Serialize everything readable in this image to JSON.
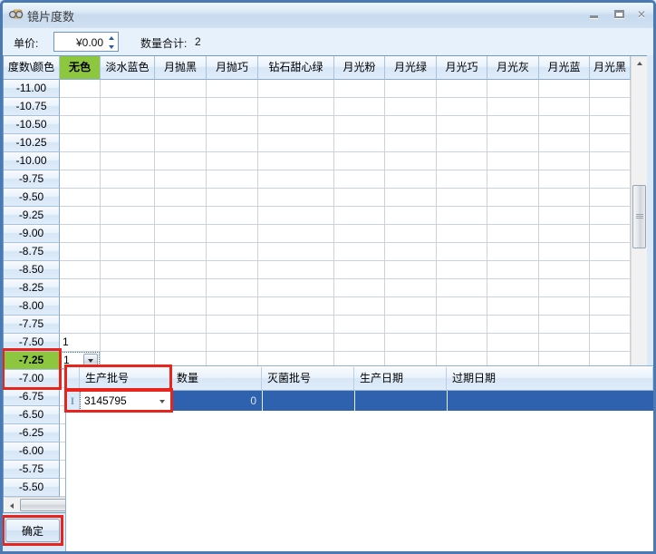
{
  "window": {
    "title": "镜片度数",
    "buttons": {
      "minimize": "minimize",
      "maximize": "maximize",
      "close": "✕"
    }
  },
  "toolbar": {
    "unit_price_label": "单价:",
    "unit_price_value": "¥0.00",
    "quantity_total_label": "数量合计:",
    "quantity_total_value": "2"
  },
  "grid": {
    "corner_header": "度数\\颜色",
    "columns": [
      "无色",
      "淡水蓝色",
      "月抛黑",
      "月抛巧",
      "钻石甜心绿",
      "月光粉",
      "月光绿",
      "月光巧",
      "月光灰",
      "月光蓝",
      "月光黑"
    ],
    "selected_column": "无色",
    "rows": [
      "-11.00",
      "-10.75",
      "-10.50",
      "-10.25",
      "-10.00",
      "-9.75",
      "-9.50",
      "-9.25",
      "-9.00",
      "-8.75",
      "-8.50",
      "-8.25",
      "-8.00",
      "-7.75",
      "-7.50",
      "-7.25",
      "-7.00",
      "-6.75",
      "-6.50",
      "-6.25",
      "-6.00",
      "-5.75",
      "-5.50"
    ],
    "selected_row": "-7.25",
    "cells": [
      {
        "row": "-7.50",
        "column": "无色",
        "value": "1",
        "editing": false
      },
      {
        "row": "-7.25",
        "column": "无色",
        "value": "1",
        "editing": true
      }
    ]
  },
  "batch_panel": {
    "columns": [
      "生产批号",
      "数量",
      "灭菌批号",
      "生产日期",
      "过期日期"
    ],
    "rows": [
      {
        "生产批号": "3145795",
        "数量": "0",
        "灭菌批号": "",
        "生产日期": "",
        "过期日期": ""
      }
    ],
    "selected_batch": "3145795"
  },
  "footer": {
    "ok_label": "确定"
  },
  "colors": {
    "selection_green": "#8dc63f",
    "selection_blue": "#2f62ae",
    "annotation_red": "#e8251d"
  }
}
